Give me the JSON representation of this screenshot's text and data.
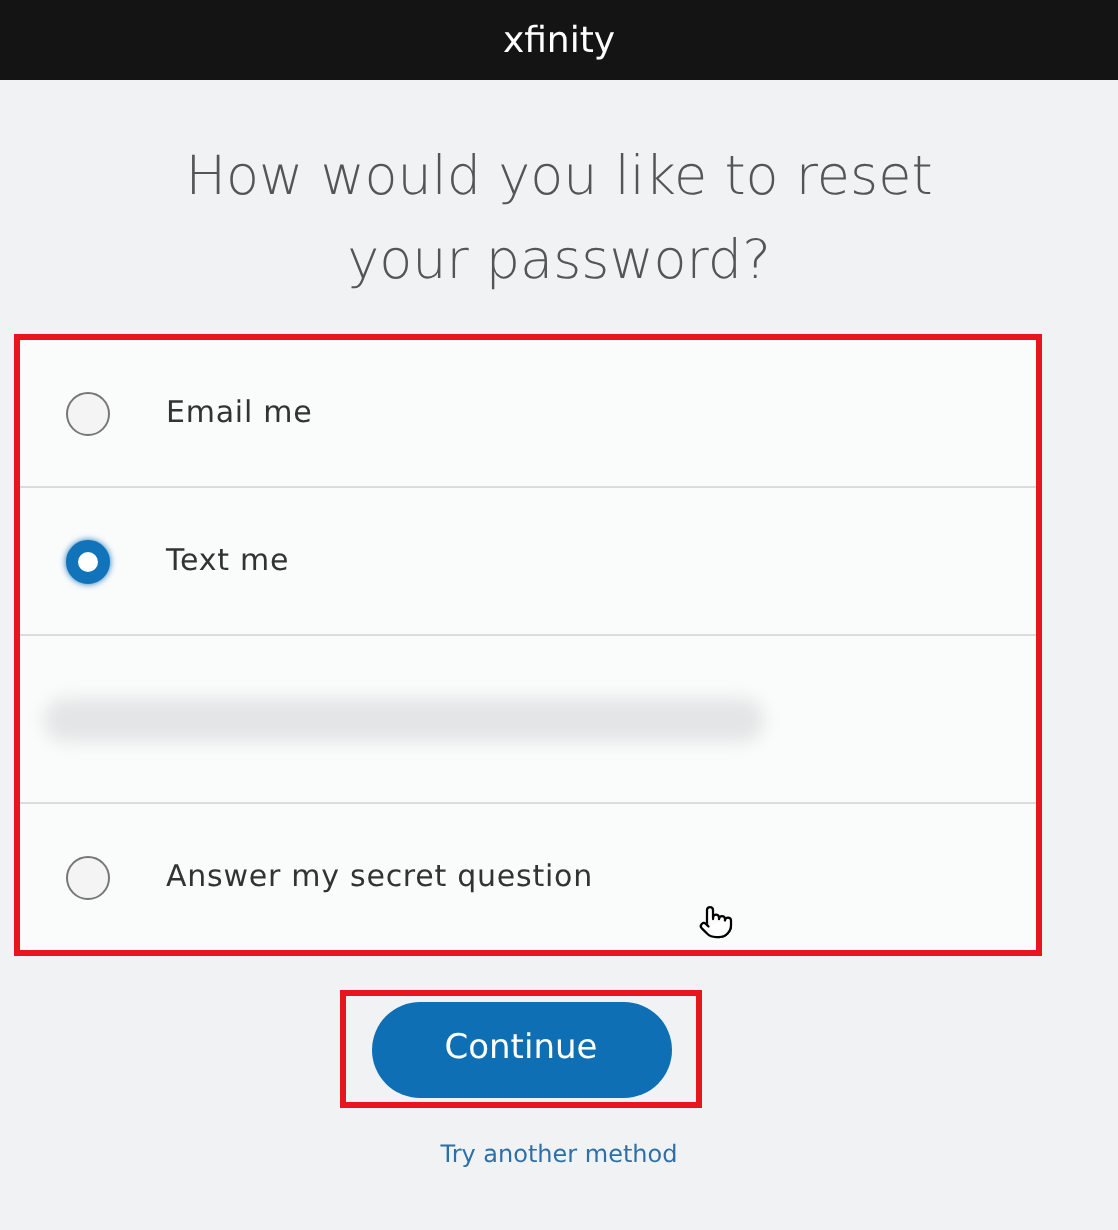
{
  "header": {
    "logo": "xfinity"
  },
  "heading": "How would you like to reset your password?",
  "options": [
    {
      "kind": "radio",
      "label": "Email me",
      "selected": false
    },
    {
      "kind": "radio",
      "label": "Text me",
      "selected": true
    },
    {
      "kind": "blurred"
    },
    {
      "kind": "radio",
      "label": "Answer my secret question",
      "selected": false
    }
  ],
  "continue_button": "Continue",
  "link": "Try another method"
}
